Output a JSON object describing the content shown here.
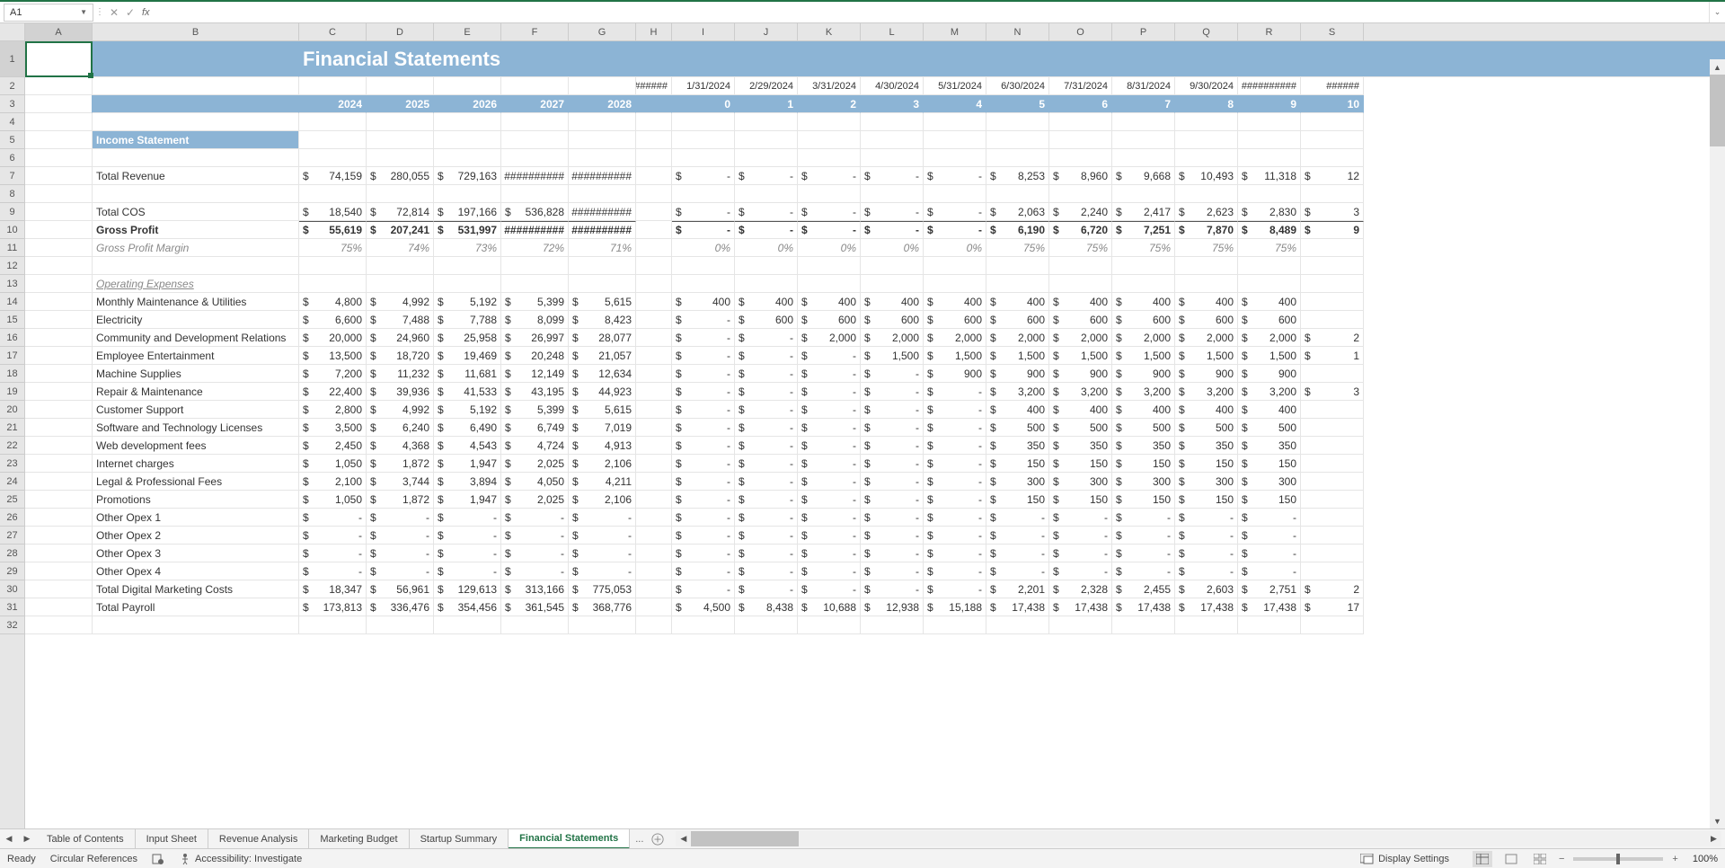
{
  "nameBox": "A1",
  "fxLabel": "fx",
  "title": "Financial Statements",
  "colLetters": [
    "A",
    "B",
    "C",
    "D",
    "E",
    "F",
    "G",
    "H",
    "I",
    "J",
    "K",
    "L",
    "M",
    "N",
    "O",
    "P",
    "Q",
    "R",
    "S"
  ],
  "rowCount": 32,
  "dateRow": [
    "##########",
    "1/31/2024",
    "2/29/2024",
    "3/31/2024",
    "4/30/2024",
    "5/31/2024",
    "6/30/2024",
    "7/31/2024",
    "8/31/2024",
    "9/30/2024",
    "##########",
    "######"
  ],
  "yearHeaders": [
    "2024",
    "2025",
    "2026",
    "2027",
    "2028"
  ],
  "monthHeaders": [
    "0",
    "1",
    "2",
    "3",
    "4",
    "5",
    "6",
    "7",
    "8",
    "9",
    "10"
  ],
  "sectionHeader": "Income Statement",
  "rows": {
    "totalRevenue": {
      "label": "Total Revenue",
      "y": [
        "74,159",
        "280,055",
        "729,163",
        "##########",
        "##########"
      ],
      "m": [
        "-",
        "-",
        "-",
        "-",
        "-",
        "8,253",
        "8,960",
        "9,668",
        "10,493",
        "11,318",
        "12"
      ]
    },
    "totalCOS": {
      "label": "Total COS",
      "y": [
        "18,540",
        "72,814",
        "197,166",
        "536,828",
        "##########"
      ],
      "m": [
        "-",
        "-",
        "-",
        "-",
        "-",
        "2,063",
        "2,240",
        "2,417",
        "2,623",
        "2,830",
        "3"
      ]
    },
    "grossProfit": {
      "label": "Gross Profit",
      "y": [
        "55,619",
        "207,241",
        "531,997",
        "##########",
        "##########"
      ],
      "m": [
        "-",
        "-",
        "-",
        "-",
        "-",
        "6,190",
        "6,720",
        "7,251",
        "7,870",
        "8,489",
        "9"
      ]
    },
    "grossMargin": {
      "label": "Gross Profit Margin",
      "y": [
        "75%",
        "74%",
        "73%",
        "72%",
        "71%"
      ],
      "m": [
        "0%",
        "0%",
        "0%",
        "0%",
        "0%",
        "75%",
        "75%",
        "75%",
        "75%",
        "75%",
        ""
      ]
    },
    "opexHeader": "Operating Expenses",
    "opex": [
      {
        "label": "Monthly Maintenance & Utilities",
        "y": [
          "4,800",
          "4,992",
          "5,192",
          "5,399",
          "5,615"
        ],
        "m": [
          "400",
          "400",
          "400",
          "400",
          "400",
          "400",
          "400",
          "400",
          "400",
          "400",
          ""
        ]
      },
      {
        "label": "Electricity",
        "y": [
          "6,600",
          "7,488",
          "7,788",
          "8,099",
          "8,423"
        ],
        "m": [
          "-",
          "600",
          "600",
          "600",
          "600",
          "600",
          "600",
          "600",
          "600",
          "600",
          ""
        ]
      },
      {
        "label": "Community and Development Relations",
        "y": [
          "20,000",
          "24,960",
          "25,958",
          "26,997",
          "28,077"
        ],
        "m": [
          "-",
          "-",
          "2,000",
          "2,000",
          "2,000",
          "2,000",
          "2,000",
          "2,000",
          "2,000",
          "2,000",
          "2"
        ]
      },
      {
        "label": "Employee Entertainment",
        "y": [
          "13,500",
          "18,720",
          "19,469",
          "20,248",
          "21,057"
        ],
        "m": [
          "-",
          "-",
          "-",
          "1,500",
          "1,500",
          "1,500",
          "1,500",
          "1,500",
          "1,500",
          "1,500",
          "1"
        ]
      },
      {
        "label": "Machine Supplies",
        "y": [
          "7,200",
          "11,232",
          "11,681",
          "12,149",
          "12,634"
        ],
        "m": [
          "-",
          "-",
          "-",
          "-",
          "900",
          "900",
          "900",
          "900",
          "900",
          "900",
          ""
        ]
      },
      {
        "label": "Repair & Maintenance",
        "y": [
          "22,400",
          "39,936",
          "41,533",
          "43,195",
          "44,923"
        ],
        "m": [
          "-",
          "-",
          "-",
          "-",
          "-",
          "3,200",
          "3,200",
          "3,200",
          "3,200",
          "3,200",
          "3"
        ]
      },
      {
        "label": "Customer Support",
        "y": [
          "2,800",
          "4,992",
          "5,192",
          "5,399",
          "5,615"
        ],
        "m": [
          "-",
          "-",
          "-",
          "-",
          "-",
          "400",
          "400",
          "400",
          "400",
          "400",
          ""
        ]
      },
      {
        "label": "Software and Technology Licenses",
        "y": [
          "3,500",
          "6,240",
          "6,490",
          "6,749",
          "7,019"
        ],
        "m": [
          "-",
          "-",
          "-",
          "-",
          "-",
          "500",
          "500",
          "500",
          "500",
          "500",
          ""
        ]
      },
      {
        "label": "Web development fees",
        "y": [
          "2,450",
          "4,368",
          "4,543",
          "4,724",
          "4,913"
        ],
        "m": [
          "-",
          "-",
          "-",
          "-",
          "-",
          "350",
          "350",
          "350",
          "350",
          "350",
          ""
        ]
      },
      {
        "label": "Internet charges",
        "y": [
          "1,050",
          "1,872",
          "1,947",
          "2,025",
          "2,106"
        ],
        "m": [
          "-",
          "-",
          "-",
          "-",
          "-",
          "150",
          "150",
          "150",
          "150",
          "150",
          ""
        ]
      },
      {
        "label": "Legal & Professional Fees",
        "y": [
          "2,100",
          "3,744",
          "3,894",
          "4,050",
          "4,211"
        ],
        "m": [
          "-",
          "-",
          "-",
          "-",
          "-",
          "300",
          "300",
          "300",
          "300",
          "300",
          ""
        ]
      },
      {
        "label": "Promotions",
        "y": [
          "1,050",
          "1,872",
          "1,947",
          "2,025",
          "2,106"
        ],
        "m": [
          "-",
          "-",
          "-",
          "-",
          "-",
          "150",
          "150",
          "150",
          "150",
          "150",
          ""
        ]
      },
      {
        "label": "Other Opex 1",
        "y": [
          "-",
          "-",
          "-",
          "-",
          "-"
        ],
        "m": [
          "-",
          "-",
          "-",
          "-",
          "-",
          "-",
          "-",
          "-",
          "-",
          "-",
          ""
        ]
      },
      {
        "label": "Other Opex 2",
        "y": [
          "-",
          "-",
          "-",
          "-",
          "-"
        ],
        "m": [
          "-",
          "-",
          "-",
          "-",
          "-",
          "-",
          "-",
          "-",
          "-",
          "-",
          ""
        ]
      },
      {
        "label": "Other Opex 3",
        "y": [
          "-",
          "-",
          "-",
          "-",
          "-"
        ],
        "m": [
          "-",
          "-",
          "-",
          "-",
          "-",
          "-",
          "-",
          "-",
          "-",
          "-",
          ""
        ]
      },
      {
        "label": "Other Opex 4",
        "y": [
          "-",
          "-",
          "-",
          "-",
          "-"
        ],
        "m": [
          "-",
          "-",
          "-",
          "-",
          "-",
          "-",
          "-",
          "-",
          "-",
          "-",
          ""
        ]
      },
      {
        "label": "Total Digital Marketing Costs",
        "y": [
          "18,347",
          "56,961",
          "129,613",
          "313,166",
          "775,053"
        ],
        "m": [
          "-",
          "-",
          "-",
          "-",
          "-",
          "2,201",
          "2,328",
          "2,455",
          "2,603",
          "2,751",
          "2"
        ]
      },
      {
        "label": "Total Payroll",
        "y": [
          "173,813",
          "336,476",
          "354,456",
          "361,545",
          "368,776"
        ],
        "m": [
          "4,500",
          "8,438",
          "10,688",
          "12,938",
          "15,188",
          "17,438",
          "17,438",
          "17,438",
          "17,438",
          "17,438",
          "17"
        ]
      }
    ]
  },
  "tabs": [
    "Table of Contents",
    "Input Sheet",
    "Revenue Analysis",
    "Marketing Budget",
    "Startup Summary",
    "Financial Statements"
  ],
  "activeTab": 5,
  "tabMore": "...",
  "status": {
    "ready": "Ready",
    "circ": "Circular References",
    "acc": "Accessibility: Investigate",
    "disp": "Display Settings",
    "zoom": "100%"
  }
}
